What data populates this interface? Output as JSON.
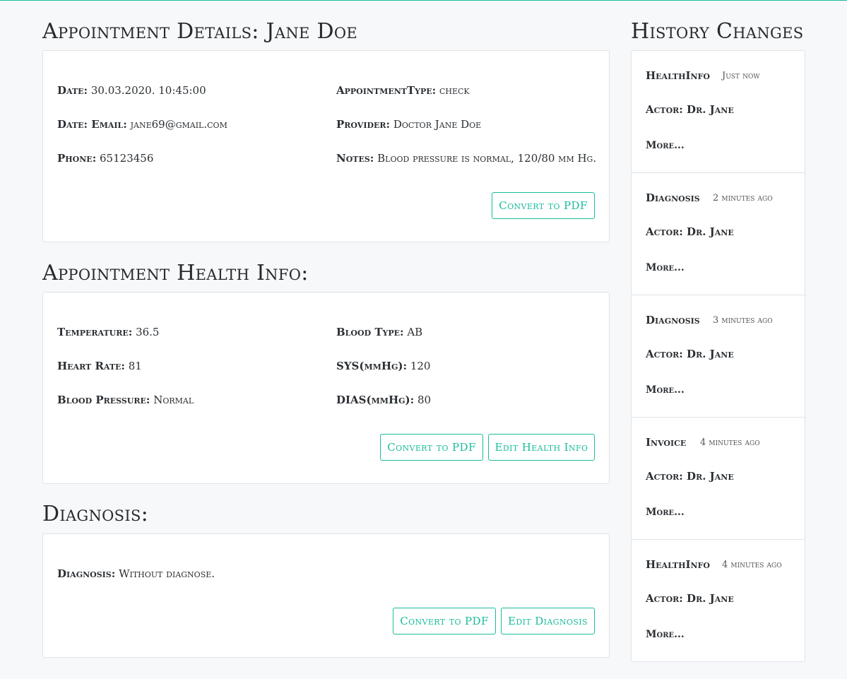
{
  "appointment": {
    "title": "Appointment Details: Jane Doe",
    "fields": [
      {
        "label": "Date:",
        "value": "30.03.2020. 10:45:00"
      },
      {
        "label": "AppointmentType:",
        "value": "check"
      },
      {
        "label": "Date: Email:",
        "value": "jane69@gmail.com"
      },
      {
        "label": "Provider:",
        "value": "Doctor Jane Doe"
      },
      {
        "label": "Phone:",
        "value": "65123456"
      },
      {
        "label": "Notes:",
        "value": "Blood pressure is normal, 120/80 mm Hg."
      }
    ],
    "convert_label": "Convert to PDF"
  },
  "health": {
    "title": "Appointment Health Info:",
    "fields": [
      {
        "label": "Temperature:",
        "value": "36.5"
      },
      {
        "label": "Blood Type:",
        "value": "AB"
      },
      {
        "label": "Heart Rate:",
        "value": "81"
      },
      {
        "label": "SYS(mmHg):",
        "value": "120"
      },
      {
        "label": "Blood Pressure:",
        "value": "Normal"
      },
      {
        "label": "DIAS(mmHg):",
        "value": "80"
      }
    ],
    "convert_label": "Convert to PDF",
    "edit_label": "Edit Health Info"
  },
  "diagnosis": {
    "title": "Diagnosis:",
    "label": "Diagnosis:",
    "value": "Without diagnose.",
    "convert_label": "Convert to PDF",
    "edit_label": "Edit Diagnosis"
  },
  "history": {
    "title": "History Changes",
    "items": [
      {
        "title": "HealthInfo",
        "time": "Just now",
        "actor": "Actor: Dr. Jane",
        "more": "More..."
      },
      {
        "title": "Diagnosis",
        "time": "2 minutes ago",
        "actor": "Actor: Dr. Jane",
        "more": "More..."
      },
      {
        "title": "Diagnosis",
        "time": "3 minutes ago",
        "actor": "Actor: Dr. Jane",
        "more": "More..."
      },
      {
        "title": "Invoice",
        "time": "4 minutes ago",
        "actor": "Actor: Dr. Jane",
        "more": "More..."
      },
      {
        "title": "HealthInfo",
        "time": "4 minutes ago",
        "actor": "Actor: Dr. Jane",
        "more": "More..."
      }
    ]
  },
  "colors": {
    "accent": "#1abc9c",
    "background": "#f7f8fa",
    "card_border": "#dfe2e6"
  }
}
